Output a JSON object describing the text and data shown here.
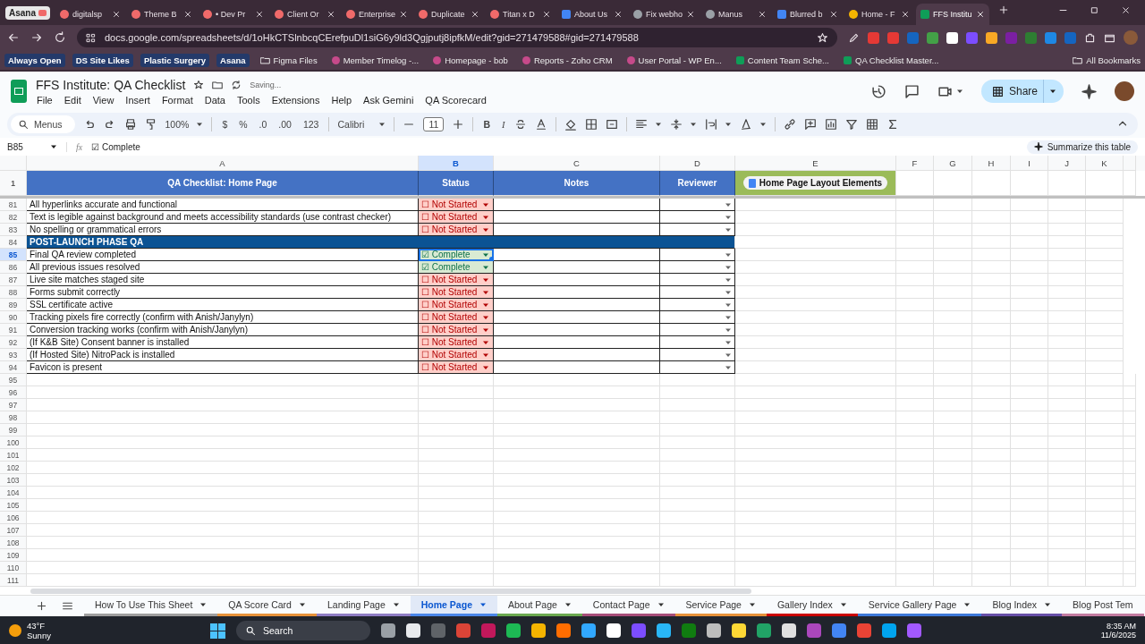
{
  "browser": {
    "group_label": "Asana",
    "tabs": [
      {
        "label": "digitalsp",
        "kind": "dots",
        "selected": false
      },
      {
        "label": "Theme B",
        "kind": "dots",
        "selected": false
      },
      {
        "label": "• Dev Pr",
        "kind": "dots",
        "selected": false
      },
      {
        "label": "Client Or",
        "kind": "dots",
        "selected": false
      },
      {
        "label": "Enterprise",
        "kind": "dots",
        "selected": false
      },
      {
        "label": "Duplicate",
        "kind": "dots",
        "selected": false
      },
      {
        "label": "Titan x D",
        "kind": "dots",
        "selected": false
      },
      {
        "label": "About Us",
        "kind": "doc",
        "selected": false
      },
      {
        "label": "Fix webho",
        "kind": "globe",
        "selected": false
      },
      {
        "label": "Manus",
        "kind": "globe",
        "selected": false
      },
      {
        "label": "Blurred b",
        "kind": "doc",
        "selected": false
      },
      {
        "label": "Home - F",
        "kind": "circle",
        "selected": false
      },
      {
        "label": "FFS Institu",
        "kind": "sheet",
        "selected": true
      }
    ],
    "url": "docs.google.com/spreadsheets/d/1oHkCTSlnbcqCErefpuDl1siG6y9ld3Qgjputj8ipfkM/edit?gid=271479588#gid=271479588",
    "bookmarks": [
      {
        "label": "Always Open",
        "kind": "chip"
      },
      {
        "label": "DS Site Likes",
        "kind": "chip"
      },
      {
        "label": "Plastic Surgery",
        "kind": "chip"
      },
      {
        "label": "Asana",
        "kind": "chip"
      },
      {
        "label": "Figma Files",
        "kind": "folder"
      },
      {
        "label": "Member Timelog -...",
        "kind": "site"
      },
      {
        "label": "Homepage - bob",
        "kind": "site"
      },
      {
        "label": "Reports - Zoho CRM",
        "kind": "site"
      },
      {
        "label": "User Portal - WP En...",
        "kind": "site"
      },
      {
        "label": "Content Team Sche...",
        "kind": "sheet"
      },
      {
        "label": "QA Checklist Master...",
        "kind": "sheet"
      }
    ],
    "all_bookmarks": "All Bookmarks"
  },
  "doc": {
    "title": "FFS Institute: QA Checklist",
    "status": "Saving...",
    "menus": [
      "File",
      "Edit",
      "View",
      "Insert",
      "Format",
      "Data",
      "Tools",
      "Extensions",
      "Help",
      "Ask Gemini",
      "QA Scorecard"
    ],
    "share": "Share"
  },
  "toolbar": {
    "search": "Menus",
    "zoom": "100%",
    "currency": "$",
    "percent": "%",
    "decrease_decimal": ".0",
    "increase_decimal": ".00",
    "number_format": "123",
    "font": "Calibri",
    "font_size": "11",
    "bold": "B",
    "italic": "I"
  },
  "summarize": "Summarize this table",
  "formula_bar": {
    "cell": "B85",
    "fx": "fx",
    "value": "☑ Complete"
  },
  "columns": [
    {
      "label": "A",
      "selected": false
    },
    {
      "label": "B",
      "selected": true
    },
    {
      "label": "C",
      "selected": false
    },
    {
      "label": "D",
      "selected": false
    },
    {
      "label": "E",
      "selected": false
    },
    {
      "label": "F",
      "selected": false
    },
    {
      "label": "G",
      "selected": false
    },
    {
      "label": "H",
      "selected": false
    },
    {
      "label": "I",
      "selected": false
    },
    {
      "label": "J",
      "selected": false
    },
    {
      "label": "K",
      "selected": false
    }
  ],
  "header_row": {
    "number": "1",
    "task": "QA Checklist: Home Page",
    "status": "Status",
    "notes": "Notes",
    "reviewer": "Reviewer",
    "link_chip": "Home Page Layout Elements"
  },
  "rows": [
    {
      "number": "81",
      "kind": "item",
      "task": "All hyperlinks accurate and functional",
      "status": "☐ Not Started",
      "complete": false,
      "selected": false
    },
    {
      "number": "82",
      "kind": "item",
      "task": "Text is legible against background and meets accessibility standards (use contrast checker)",
      "status": "☐ Not Started",
      "complete": false,
      "selected": false
    },
    {
      "number": "83",
      "kind": "item",
      "task": "No spelling or grammatical errors",
      "status": "☐ Not Started",
      "complete": false,
      "selected": false
    },
    {
      "number": "84",
      "kind": "section",
      "task": "POST-LAUNCH PHASE QA",
      "selected": false
    },
    {
      "number": "85",
      "kind": "item",
      "task": "Final QA review completed",
      "status": "☑ Complete",
      "complete": true,
      "selected": true
    },
    {
      "number": "86",
      "kind": "item",
      "task": "All previous issues resolved",
      "status": "☑ Complete",
      "complete": true,
      "selected": false
    },
    {
      "number": "87",
      "kind": "item",
      "task": "Live site matches staged site",
      "status": "☐ Not Started",
      "complete": false,
      "selected": false
    },
    {
      "number": "88",
      "kind": "item",
      "task": "Forms submit correctly",
      "status": "☐ Not Started",
      "complete": false,
      "selected": false
    },
    {
      "number": "89",
      "kind": "item",
      "task": "SSL certificate active",
      "status": "☐ Not Started",
      "complete": false,
      "selected": false
    },
    {
      "number": "90",
      "kind": "item",
      "task": "Tracking pixels fire correctly (confirm with Anish/Janylyn)",
      "status": "☐ Not Started",
      "complete": false,
      "selected": false
    },
    {
      "number": "91",
      "kind": "item",
      "task": "Conversion tracking works (confirm with Anish/Janylyn)",
      "status": "☐ Not Started",
      "complete": false,
      "selected": false
    },
    {
      "number": "92",
      "kind": "item",
      "task": "(If K&B Site) Consent banner is installed",
      "status": "☐ Not Started",
      "complete": false,
      "selected": false
    },
    {
      "number": "93",
      "kind": "item",
      "task": "(If Hosted Site) NitroPack is installed",
      "status": "☐ Not Started",
      "complete": false,
      "selected": false
    },
    {
      "number": "94",
      "kind": "item",
      "task": "Favicon is present",
      "status": "☐ Not Started",
      "complete": false,
      "selected": false
    }
  ],
  "empty_rows": [
    "95",
    "96",
    "97",
    "98",
    "99",
    "100",
    "101",
    "102",
    "103",
    "104",
    "105",
    "106",
    "107",
    "108",
    "109",
    "110",
    "111"
  ],
  "sheet_tabs": [
    {
      "label": "How To Use This Sheet",
      "color": "#9e9e9e",
      "selected": false
    },
    {
      "label": "QA Score Card",
      "color": "#e69138",
      "selected": false
    },
    {
      "label": "Landing Page",
      "color": "#8e7cc3",
      "selected": false
    },
    {
      "label": "Home Page",
      "color": "#4a86e8",
      "selected": true
    },
    {
      "label": "About Page",
      "color": "#6aa84f",
      "selected": false
    },
    {
      "label": "Contact Page",
      "color": "#a64d79",
      "selected": false
    },
    {
      "label": "Service Page",
      "color": "#e69138",
      "selected": false
    },
    {
      "label": "Gallery Index",
      "color": "#cc0000",
      "selected": false
    },
    {
      "label": "Service Gallery Page",
      "color": "#3c78d8",
      "selected": false
    },
    {
      "label": "Blog Index",
      "color": "#674ea7",
      "selected": false
    },
    {
      "label": "Blog Post Tem",
      "color": "#c27ba0",
      "selected": false
    }
  ],
  "taskbar": {
    "temperature": "43°F",
    "weather": "Sunny",
    "search": "Search",
    "time": "8:35 AM",
    "date": "11/6/2025"
  }
}
